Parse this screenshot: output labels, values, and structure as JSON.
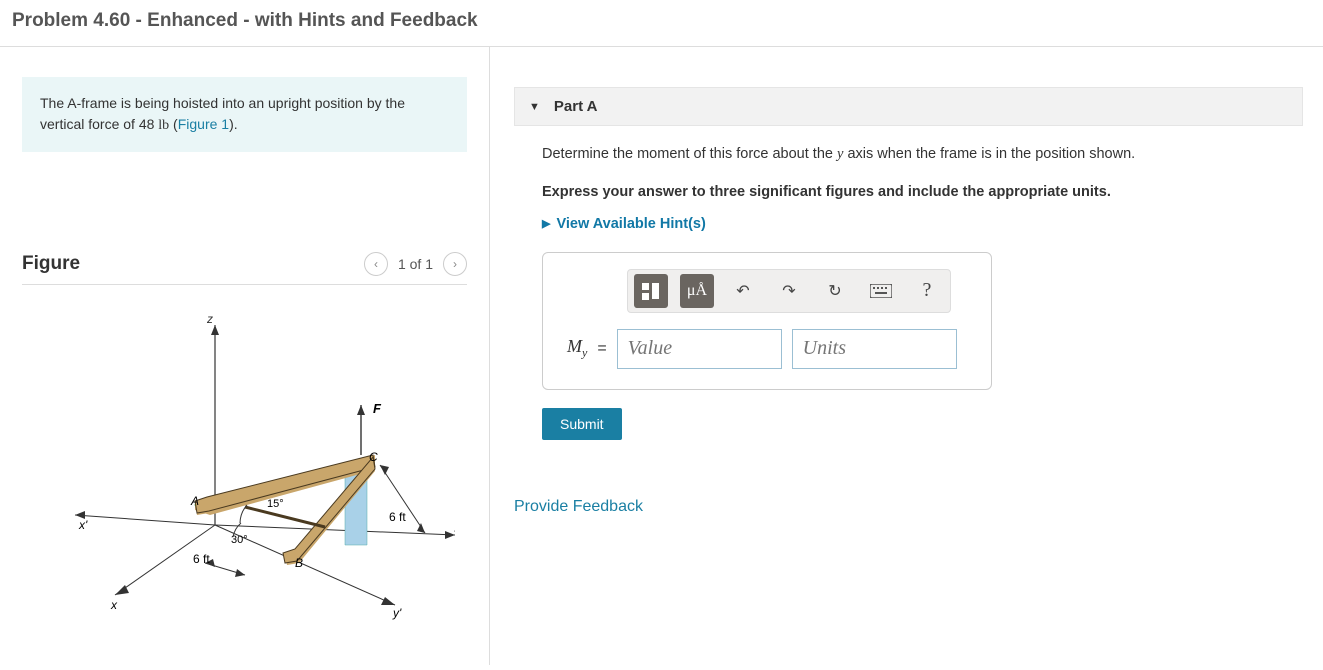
{
  "header": {
    "title": "Problem 4.60 - Enhanced - with Hints and Feedback"
  },
  "prompt": {
    "text_a": "The A-frame is being hoisted into an upright position by the vertical force of 48 ",
    "unit": "lb",
    "text_b": " (",
    "link": "Figure 1",
    "text_c": ")."
  },
  "figure": {
    "title": "Figure",
    "nav_label": "1 of 1",
    "labels": {
      "z": "z",
      "F": "F",
      "C": "C",
      "A": "A",
      "B": "B",
      "x": "x",
      "y": "y",
      "xp": "x'",
      "yp": "y'",
      "ang15": "15°",
      "ang30": "30°",
      "len6a": "6 ft",
      "len6b": "6 ft"
    }
  },
  "part": {
    "label": "Part A",
    "question_a": "Determine the moment of this force about the ",
    "axis": "y",
    "question_b": " axis when the frame is in the position shown.",
    "instruction": "Express your answer to three significant figures and include the appropriate units.",
    "hints_label": "View Available Hint(s)",
    "answer": {
      "symbol": "M",
      "subscript": "y",
      "eq": "=",
      "value_placeholder": "Value",
      "units_placeholder": "Units"
    },
    "toolbar": {
      "mu": "μÅ",
      "undo": "↶",
      "redo": "↷",
      "reset": "↻",
      "kbd": "⌨",
      "help": "?"
    },
    "submit": "Submit"
  },
  "feedback": {
    "label": "Provide Feedback"
  }
}
